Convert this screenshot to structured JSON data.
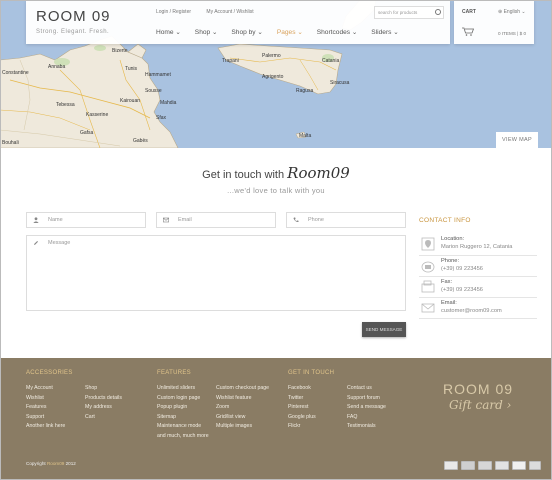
{
  "header": {
    "logo": "ROOM 09",
    "tagline": "Strong. Elegant. Fresh.",
    "top_links": [
      "Login / Register",
      "My Account / Wishlist"
    ],
    "search_placeholder": "search for products",
    "nav": [
      {
        "label": "Home ⌄",
        "active": false
      },
      {
        "label": "Shop ⌄",
        "active": false
      },
      {
        "label": "Shop by ⌄",
        "active": false
      },
      {
        "label": "Pages ⌄",
        "active": true
      },
      {
        "label": "Shortcodes ⌄",
        "active": false
      },
      {
        "label": "Sliders ⌄",
        "active": false
      }
    ],
    "cart_label": "CART",
    "language": "⊕ English ⌄",
    "cart_summary": "0 ITEMS | $ 0"
  },
  "map": {
    "labels": [
      "Palermo",
      "Catania",
      "Malta",
      "Bizerte",
      "Tunis",
      "Sousse",
      "Sfax",
      "Gabès",
      "Kairouan",
      "Annaba",
      "Constantine",
      "Tebessa",
      "Mahdia",
      "Hammamet",
      "Trapani",
      "Agrigento",
      "Ragusa",
      "Siracusa",
      "Kasserine",
      "Gafsa",
      "Bouhali"
    ],
    "view_map": "VIEW MAP"
  },
  "contact": {
    "heading": "Get in touch with",
    "brand": "Room09",
    "subheading": "...we'd love to talk with you",
    "fields": {
      "name_placeholder": "Name",
      "email_placeholder": "Email",
      "phone_placeholder": "Phone",
      "message_placeholder": "Message"
    },
    "send_label": "SEND MESSAGE",
    "info_title": "CONTACT INFO",
    "info": [
      {
        "label": "Location:",
        "value": "Marion Ruggero 12, Catania",
        "icon": "location-icon"
      },
      {
        "label": "Phone:",
        "value": "(+39) 09 223456",
        "icon": "phone-icon"
      },
      {
        "label": "Fax:",
        "value": "(+39) 09 223456",
        "icon": "fax-icon"
      },
      {
        "label": "Email:",
        "value": "customer@room09.com",
        "icon": "email-icon"
      }
    ]
  },
  "footer": {
    "accessories": {
      "title": "ACCESSORIES",
      "col1": [
        "My Account",
        "Wishlist",
        "Features",
        "Support",
        "Another link here"
      ],
      "col2": [
        "Shop",
        "Products details",
        "My address",
        "Cart"
      ]
    },
    "features": {
      "title": "FEATURES",
      "col1": [
        "Unlimited sliders",
        "Custom login page",
        "Popup plugin",
        "Sitemap",
        "Maintenance mode",
        "and much, much more"
      ],
      "col2": [
        "Custom checkout page",
        "Wishlist feature",
        "Zoom",
        "Grid/list view",
        "Multiple images"
      ]
    },
    "get_in_touch": {
      "title": "GET IN TOUCH",
      "col1": [
        "Facebook",
        "Twitter",
        "Pinterest",
        "Google plus",
        "Flickr"
      ],
      "col2": [
        "Contact us",
        "Support forum",
        "Send a message",
        "FAQ",
        "Testimonials"
      ]
    },
    "logo": "ROOM 09",
    "gift_card": "Gift card ›",
    "copyright_prefix": "Copyright",
    "copyright_brand": "Room09",
    "copyright_year": "2012"
  }
}
